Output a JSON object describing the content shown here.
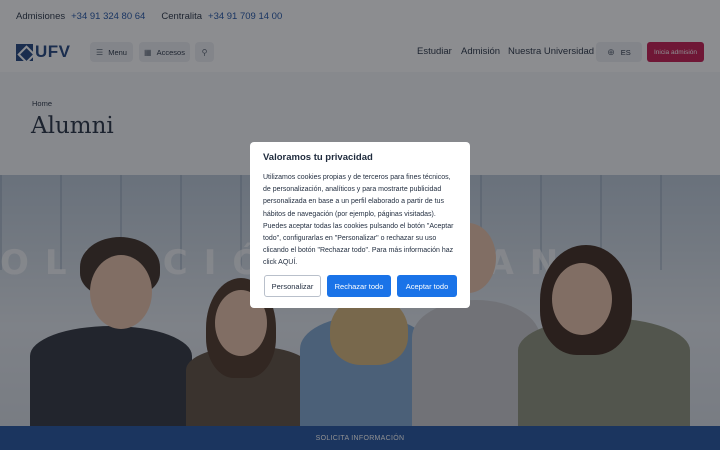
{
  "topbar": {
    "admissions_label": "Admisiones",
    "admissions_phone": "+34 91 324 80 64",
    "switchboard_label": "Centralita",
    "switchboard_phone": "+34 91 709 14 00"
  },
  "header": {
    "logo_text": "UFV",
    "menu_label": "Menu",
    "access_label": "Accesos",
    "nav": [
      "Estudiar",
      "Admisión",
      "Nuestra Universidad"
    ],
    "language": "ES",
    "cta_label": "Inicia admisión"
  },
  "page": {
    "breadcrumb": "Home",
    "title": "Alumni"
  },
  "hero": {
    "sign_text": "OLECCIÓN  HUMANA"
  },
  "bottom_band": {
    "label": "SOLICITA INFORMACIÓN"
  },
  "cookie_modal": {
    "title": "Valoramos tu privacidad",
    "body": "Utilizamos cookies propias y de terceros para fines técnicos, de personalización, analíticos y para mostrarte publicidad personalizada en base a un perfil elaborado a partir de tus hábitos de navegación (por ejemplo, páginas visitadas). Puedes aceptar todas las cookies pulsando el botón \"Aceptar todo\", configurarlas en \"Personalizar\" o rechazar su uso clicando el botón \"Rechazar todo\". Para más información haz click AQUÍ.",
    "customize_label": "Personalizar",
    "reject_label": "Rechazar todo",
    "accept_label": "Aceptar todo"
  },
  "colors": {
    "brand_navy": "#1a3e7a",
    "cta_red": "#c5124b",
    "button_blue": "#1a73e8",
    "band_blue": "#1d4f9c"
  }
}
